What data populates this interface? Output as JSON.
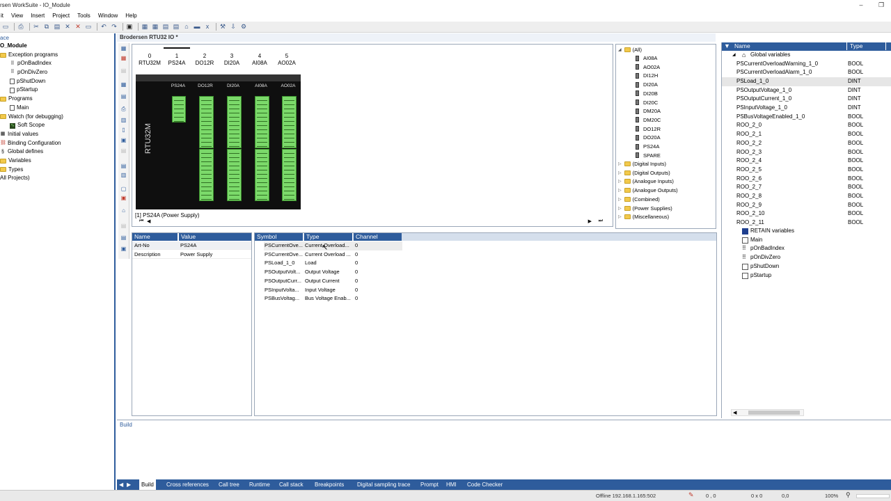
{
  "window": {
    "title": "rsen WorkSuite - IO_Module"
  },
  "menu": [
    "it",
    "View",
    "Insert",
    "Project",
    "Tools",
    "Window",
    "Help"
  ],
  "left_panel": {
    "header": "ace",
    "tree": [
      {
        "label": "O_Module",
        "icon": "none",
        "indent": 0,
        "bold": true
      },
      {
        "label": "Exception programs",
        "icon": "folder",
        "indent": 0
      },
      {
        "label": "pOnBadIndex",
        "icon": "block",
        "indent": 1
      },
      {
        "label": "pOnDivZero",
        "icon": "block",
        "indent": 1
      },
      {
        "label": "pShutDown",
        "icon": "doc",
        "indent": 1
      },
      {
        "label": "pStartup",
        "icon": "doc",
        "indent": 1
      },
      {
        "label": "Programs",
        "icon": "folder",
        "indent": 0
      },
      {
        "label": "Main",
        "icon": "doc",
        "indent": 1
      },
      {
        "label": "Watch (for debugging)",
        "icon": "folder",
        "indent": 0
      },
      {
        "label": "Soft Scope",
        "icon": "scope",
        "indent": 1
      },
      {
        "label": "Initial values",
        "icon": "grid",
        "indent": 0
      },
      {
        "label": "Binding Configuration",
        "icon": "bind",
        "indent": 0
      },
      {
        "label": "Global defines",
        "icon": "global",
        "indent": 0
      },
      {
        "label": "Variables",
        "icon": "folder",
        "indent": 0
      },
      {
        "label": "Types",
        "icon": "folder",
        "indent": 0
      },
      {
        "label": "All Projects)",
        "icon": "none",
        "indent": 0
      }
    ]
  },
  "editor": {
    "title": "Brodersen RTU32 IO *",
    "slots": [
      {
        "num": "0",
        "name": "RTU32M"
      },
      {
        "num": "1",
        "name": "PS24A"
      },
      {
        "num": "2",
        "name": "DO12R"
      },
      {
        "num": "3",
        "name": "DI20A"
      },
      {
        "num": "4",
        "name": "AI08A"
      },
      {
        "num": "5",
        "name": "AO02A"
      }
    ],
    "rack_labels": [
      "PS24A",
      "DO12R",
      "DI20A",
      "AI08A",
      "AO02A"
    ],
    "cpu_label": "RTU32M",
    "selection_info": "[1]  PS24A (Power Supply)"
  },
  "library": {
    "root": "(All)",
    "modules": [
      "AI08A",
      "AO02A",
      "DI12H",
      "DI20A",
      "DI20B",
      "DI20C",
      "DM20A",
      "DM20C",
      "DO12R",
      "DO20A",
      "PS24A",
      "SPARE"
    ],
    "groups": [
      "(Digital Inputs)",
      "(Digital Outputs)",
      "(Analogue Inputs)",
      "(Analogue Outputs)",
      "(Combined)",
      "(Power Supplies)",
      "(Miscellaneous)"
    ]
  },
  "properties": {
    "headers": {
      "name": "Name",
      "value": "Value"
    },
    "rows": [
      {
        "name": "Art-No",
        "value": "PS24A"
      },
      {
        "name": "Description",
        "value": "Power Supply"
      }
    ]
  },
  "channels": {
    "headers": {
      "symbol": "Symbol",
      "type": "Type",
      "channel": "Channel"
    },
    "rows": [
      {
        "symbol": "PSCurrentOve...",
        "type": "Current Overload...",
        "channel": "0"
      },
      {
        "symbol": "PSCurrentOve...",
        "type": "Current Overload ...",
        "channel": "0"
      },
      {
        "symbol": "PSLoad_1_0",
        "type": "Load",
        "channel": "0"
      },
      {
        "symbol": "PSOutputVolt...",
        "type": "Output Voltage",
        "channel": "0"
      },
      {
        "symbol": "PSOutputCurr...",
        "type": "Output Current",
        "channel": "0"
      },
      {
        "symbol": "PSInputVolta...",
        "type": "Input Voltage",
        "channel": "0"
      },
      {
        "symbol": "PSBusVoltag...",
        "type": "Bus Voltage Enab...",
        "channel": "0"
      }
    ]
  },
  "variables": {
    "headers": {
      "name": "Name",
      "type": "Type"
    },
    "group": "Global variables",
    "rows": [
      {
        "name": "PSCurrentOverloadWarning_1_0",
        "type": "BOOL"
      },
      {
        "name": "PSCurrentOverloadAlarm_1_0",
        "type": "BOOL"
      },
      {
        "name": "PSLoad_1_0",
        "type": "DINT"
      },
      {
        "name": "PSOutputVoltage_1_0",
        "type": "DINT"
      },
      {
        "name": "PSOutputCurrent_1_0",
        "type": "DINT"
      },
      {
        "name": "PSInputVoltage_1_0",
        "type": "DINT"
      },
      {
        "name": "PSBusVoltageEnabled_1_0",
        "type": "BOOL"
      },
      {
        "name": "ROO_2_0",
        "type": "BOOL"
      },
      {
        "name": "ROO_2_1",
        "type": "BOOL"
      },
      {
        "name": "ROO_2_2",
        "type": "BOOL"
      },
      {
        "name": "ROO_2_3",
        "type": "BOOL"
      },
      {
        "name": "ROO_2_4",
        "type": "BOOL"
      },
      {
        "name": "ROO_2_5",
        "type": "BOOL"
      },
      {
        "name": "ROO_2_6",
        "type": "BOOL"
      },
      {
        "name": "ROO_2_7",
        "type": "BOOL"
      },
      {
        "name": "ROO_2_8",
        "type": "BOOL"
      },
      {
        "name": "ROO_2_9",
        "type": "BOOL"
      },
      {
        "name": "ROO_2_10",
        "type": "BOOL"
      },
      {
        "name": "ROO_2_11",
        "type": "BOOL"
      }
    ],
    "other_groups": [
      {
        "label": "RETAIN variables",
        "icon": "retain"
      },
      {
        "label": "Main",
        "icon": "doc"
      },
      {
        "label": "pOnBadIndex",
        "icon": "block"
      },
      {
        "label": "pOnDivZero",
        "icon": "block"
      },
      {
        "label": "pShutDown",
        "icon": "doc"
      },
      {
        "label": "pStartup",
        "icon": "doc"
      }
    ]
  },
  "build_panel": {
    "title": "Build"
  },
  "bottom_tabs": [
    "Build",
    "Cross references",
    "Call tree",
    "Runtime",
    "Call stack",
    "Breakpoints",
    "Digital sampling trace",
    "Prompt",
    "HMI",
    "Code Checker"
  ],
  "status": {
    "connection": "Offline  192.168.1.165:502",
    "pos1": "0 , 0",
    "pos2": "0 x 0",
    "pos3": "0,0",
    "zoom": "100%"
  },
  "colors": {
    "accent": "#2e5c9c",
    "terminal_green": "#7bd96a",
    "rack_black": "#0f0f0f"
  }
}
